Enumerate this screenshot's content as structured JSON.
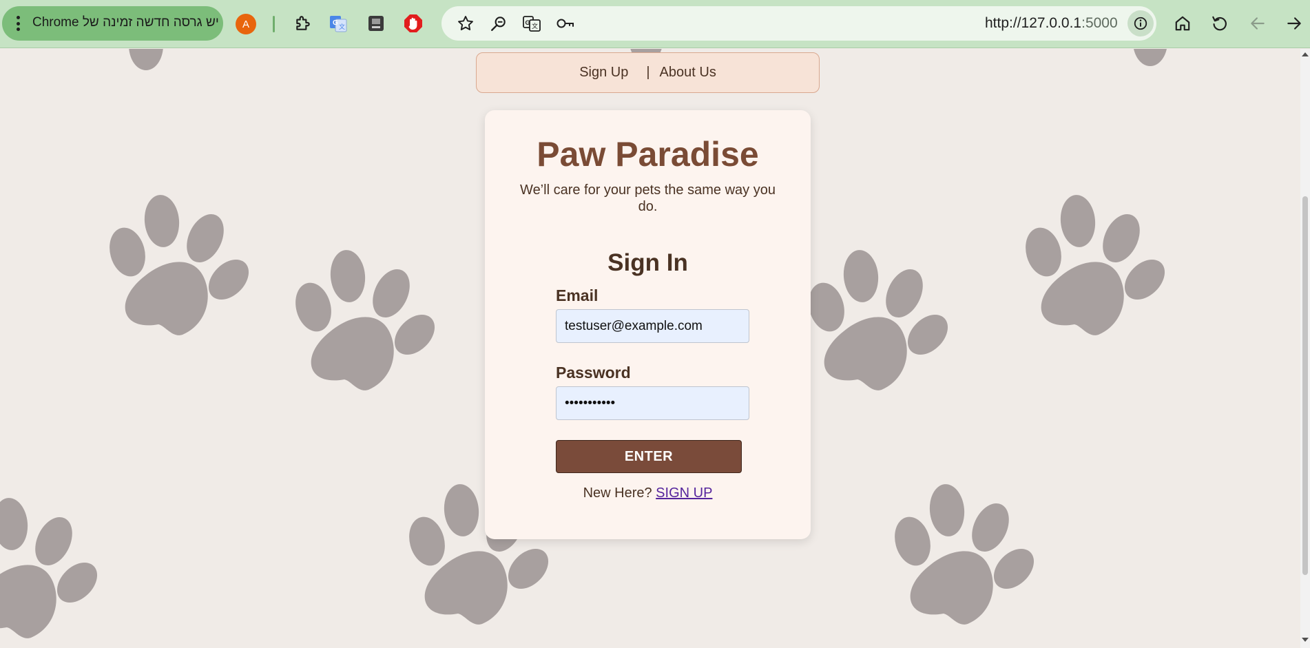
{
  "browser": {
    "update_banner": "יש גרסה חדשה זמינה של Chrome",
    "profile_initial": "A",
    "url_host": "http://127.0.0.1",
    "url_port": ":5000",
    "icons": [
      "menu-dots-icon",
      "extensions-icon",
      "google-translate-icon",
      "extension-app-icon",
      "adblock-icon",
      "bookmark-star-icon",
      "zoom-icon",
      "translate-page-icon",
      "password-key-icon",
      "site-info-icon",
      "home-icon",
      "reload-icon",
      "back-arrow-icon",
      "forward-arrow-icon"
    ]
  },
  "nav": {
    "signup_link": "Sign Up",
    "separator": "|",
    "about_link": "About Us"
  },
  "card": {
    "brand": "Paw Paradise",
    "tagline": "We’ll care for your pets the same way you do.",
    "title": "Sign In",
    "email_label": "Email",
    "email_value": "testuser@example.com",
    "password_label": "Password",
    "password_value": "•••••••••••",
    "enter_button": "ENTER",
    "new_here_text": "New Here?",
    "signup_link": "SIGN UP"
  },
  "colors": {
    "background": "#f0ebe7",
    "paw": "#a8a09f",
    "brand": "#7a4b35",
    "button": "#7a4b3a",
    "nav_bar": "#f7e3d7",
    "card": "#fdf4ef",
    "link": "#55249c"
  }
}
